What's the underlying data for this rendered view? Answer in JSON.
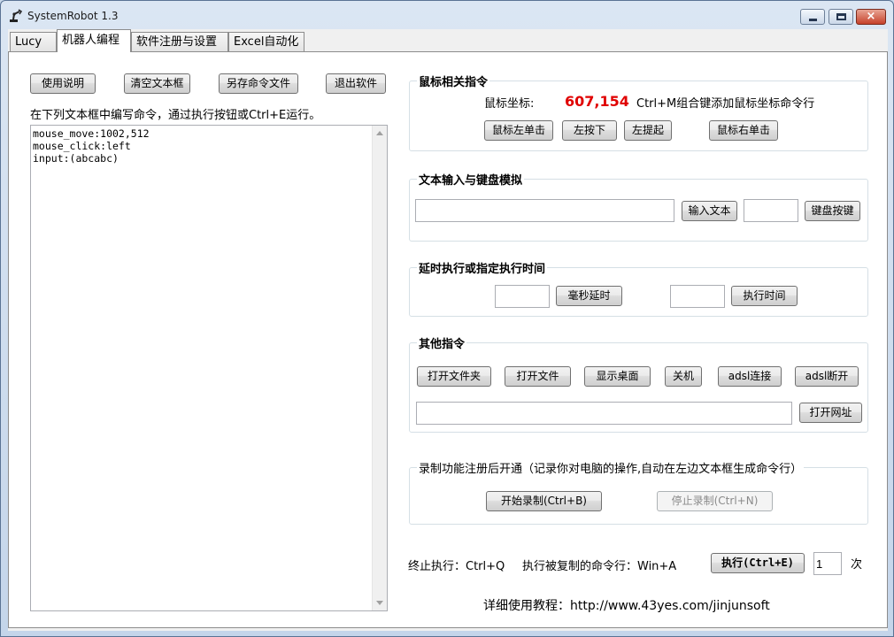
{
  "window": {
    "title": "SystemRobot 1.3",
    "icon": "robot-arm-icon",
    "controls": {
      "minimize": "minimize-icon",
      "maximize": "maximize-icon",
      "close": "×"
    }
  },
  "tabs": [
    {
      "label": "Lucy"
    },
    {
      "label": "机器人编程"
    },
    {
      "label": "软件注册与设置"
    },
    {
      "label": "Excel自动化"
    }
  ],
  "toolbar": {
    "help": "使用说明",
    "clear": "清空文本框",
    "save_as": "另存命令文件",
    "exit": "退出软件"
  },
  "editor": {
    "instruction": "在下列文本框中编写命令，通过执行按钮或Ctrl+E运行。",
    "content": "mouse_move:1002,512\nmouse_click:left\ninput:(abcabc)"
  },
  "mouse_group": {
    "title": "鼠标相关指令",
    "coord_label": "鼠标坐标:",
    "coord_value": "607,154",
    "hint": "Ctrl+M组合键添加鼠标坐标命令行",
    "buttons": {
      "left_click": "鼠标左单击",
      "left_down": "左按下",
      "left_up": "左提起",
      "right_click": "鼠标右单击"
    }
  },
  "text_group": {
    "title": "文本输入与键盘模拟",
    "input_text_value": "",
    "input_text_button": "输入文本",
    "key_value": "",
    "key_button": "键盘按键"
  },
  "delay_group": {
    "title": "延时执行或指定执行时间",
    "ms_value": "",
    "ms_button": "毫秒延时",
    "time_value": "",
    "time_button": "执行时间"
  },
  "other_group": {
    "title": "其他指令",
    "buttons": {
      "open_folder": "打开文件夹",
      "open_file": "打开文件",
      "show_desktop": "显示桌面",
      "shutdown": "关机",
      "adsl_connect": "adsl连接",
      "adsl_disconnect": "adsl断开"
    },
    "url_value": "",
    "open_url": "打开网址"
  },
  "record_group": {
    "title": "录制功能注册后开通（记录你对电脑的操作,自动在左边文本框生成命令行）",
    "start": "开始录制(Ctrl+B)",
    "stop": "停止录制(Ctrl+N)"
  },
  "footer": {
    "stop_hint": "终止执行：Ctrl+Q",
    "copy_hint": "执行被复制的命令行：Win+A",
    "execute": "执行(Ctrl+E)",
    "repeat_value": "1",
    "times_label": "次",
    "tutorial": "详细使用教程：http://www.43yes.com/jinjunsoft"
  }
}
